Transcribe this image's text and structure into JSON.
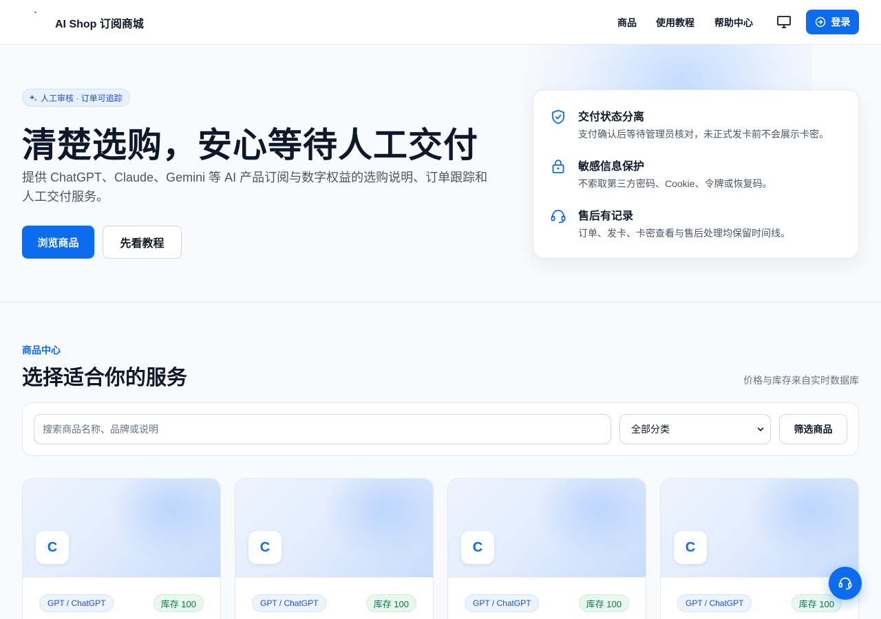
{
  "header": {
    "brand": "AI Shop 订阅商城",
    "nav": [
      "商品",
      "使用教程",
      "帮助中心"
    ],
    "login_label": "登录"
  },
  "hero": {
    "badge": "人工审核 · 订单可追踪",
    "title": "清楚选购，安心等待人工交付",
    "description": "提供 ChatGPT、Claude、Gemini 等 AI 产品订阅与数字权益的选购说明、订单跟踪和人工交付服务。",
    "primary_button": "浏览商品",
    "secondary_button": "先看教程",
    "features": [
      {
        "icon": "shield-check-icon",
        "title": "交付状态分离",
        "desc": "支付确认后等待管理员核对，未正式发卡前不会展示卡密。"
      },
      {
        "icon": "lock-icon",
        "title": "敏感信息保护",
        "desc": "不索取第三方密码、Cookie、令牌或恢复码。"
      },
      {
        "icon": "headset-icon",
        "title": "售后有记录",
        "desc": "订单、发卡、卡密查看与售后处理均保留时间线。"
      }
    ]
  },
  "products_section": {
    "kicker": "商品中心",
    "title": "选择适合你的服务",
    "note": "价格与库存来自实时数据库",
    "search_placeholder": "搜索商品名称、品牌或说明",
    "category_selected": "全部分类",
    "filter_button": "筛选商品",
    "products": [
      {
        "logo": "C",
        "brand_tag": "GPT / ChatGPT",
        "stock": "库存 100"
      },
      {
        "logo": "C",
        "brand_tag": "GPT / ChatGPT",
        "stock": "库存 100"
      },
      {
        "logo": "C",
        "brand_tag": "GPT / ChatGPT",
        "stock": "库存 100"
      },
      {
        "logo": "C",
        "brand_tag": "GPT / ChatGPT",
        "stock": "库存 100"
      }
    ]
  },
  "colors": {
    "accent": "#0b6cf0",
    "stock_green": "#047857",
    "text_dark": "#0f172a"
  }
}
